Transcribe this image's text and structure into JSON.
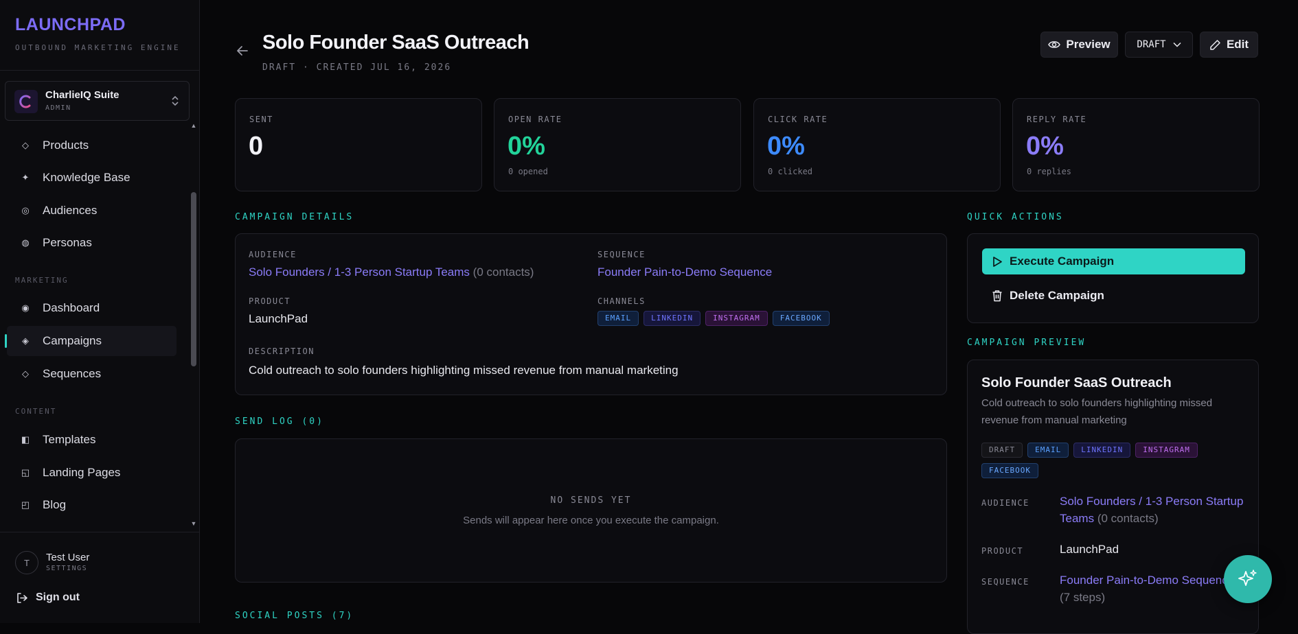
{
  "brand": {
    "title": "LAUNCHPAD",
    "subtitle": "OUTBOUND MARKETING ENGINE"
  },
  "org": {
    "name": "CharlieIQ Suite",
    "role": "ADMIN"
  },
  "nav": {
    "items_top": [
      {
        "label": "Products",
        "icon": "diamond-outline-icon"
      },
      {
        "label": "Knowledge Base",
        "icon": "sparkle-icon"
      },
      {
        "label": "Audiences",
        "icon": "target-icon"
      },
      {
        "label": "Personas",
        "icon": "persona-circle-icon"
      }
    ],
    "section_marketing": "MARKETING",
    "items_marketing": [
      {
        "label": "Dashboard",
        "icon": "radio-icon"
      },
      {
        "label": "Campaigns",
        "icon": "diamond-icon",
        "active": true
      },
      {
        "label": "Sequences",
        "icon": "diamond-outline-icon"
      }
    ],
    "section_content": "CONTENT",
    "items_content": [
      {
        "label": "Templates",
        "icon": "template-icon"
      },
      {
        "label": "Landing Pages",
        "icon": "layout-icon"
      },
      {
        "label": "Blog",
        "icon": "blog-icon"
      }
    ]
  },
  "user": {
    "initial": "T",
    "name": "Test User",
    "sub": "SETTINGS",
    "signout": "Sign out"
  },
  "header": {
    "title": "Solo Founder SaaS Outreach",
    "subtitle": "DRAFT · CREATED JUL 16, 2026",
    "preview_label": "Preview",
    "status_value": "DRAFT",
    "edit_label": "Edit"
  },
  "stats": [
    {
      "label": "SENT",
      "value": "0",
      "sub": "",
      "color": "#f2f2f7"
    },
    {
      "label": "OPEN RATE",
      "value": "0%",
      "sub": "0 opened",
      "color": "#22d39a"
    },
    {
      "label": "CLICK RATE",
      "value": "0%",
      "sub": "0 clicked",
      "color": "#3d8bff"
    },
    {
      "label": "REPLY RATE",
      "value": "0%",
      "sub": "0 replies",
      "color": "#8b7cf8"
    }
  ],
  "details": {
    "section_title": "CAMPAIGN DETAILS",
    "audience_label": "AUDIENCE",
    "audience_value": "Solo Founders / 1-3 Person Startup Teams",
    "audience_count": "(0 contacts)",
    "sequence_label": "SEQUENCE",
    "sequence_value": "Founder Pain-to-Demo Sequence",
    "product_label": "PRODUCT",
    "product_value": "LaunchPad",
    "channels_label": "CHANNELS",
    "channels": [
      "EMAIL",
      "LINKEDIN",
      "INSTAGRAM",
      "FACEBOOK"
    ],
    "description_label": "DESCRIPTION",
    "description_value": "Cold outreach to solo founders highlighting missed revenue from manual marketing"
  },
  "send_log": {
    "section_title": "SEND LOG (0)",
    "empty_title": "NO SENDS YET",
    "empty_sub": "Sends will appear here once you execute the campaign."
  },
  "social_posts": {
    "section_title": "SOCIAL POSTS (7)"
  },
  "quick_actions": {
    "section_title": "QUICK ACTIONS",
    "execute_label": "Execute Campaign",
    "delete_label": "Delete Campaign"
  },
  "preview": {
    "section_title": "CAMPAIGN PREVIEW",
    "title": "Solo Founder SaaS Outreach",
    "desc_line1": "Cold outreach to solo founders highlighting missed",
    "desc_line2": "revenue from manual marketing",
    "status_chip": "DRAFT",
    "channels": [
      "EMAIL",
      "LINKEDIN",
      "INSTAGRAM",
      "FACEBOOK"
    ],
    "audience_label": "AUDIENCE",
    "audience_line1": "Solo Founders / 1-3 Person Startup",
    "audience_line2": "Teams",
    "audience_count": "(0 contacts)",
    "product_label": "PRODUCT",
    "product_value": "LaunchPad",
    "sequence_label": "SEQUENCE",
    "sequence_value": "Founder Pain-to-Demo Sequence",
    "sequence_steps": "(7 steps)"
  },
  "colors": {
    "accent": "#2fd4c5",
    "brand": "#7c6cf6",
    "link": "#8b7cf8",
    "background": "#070709"
  }
}
